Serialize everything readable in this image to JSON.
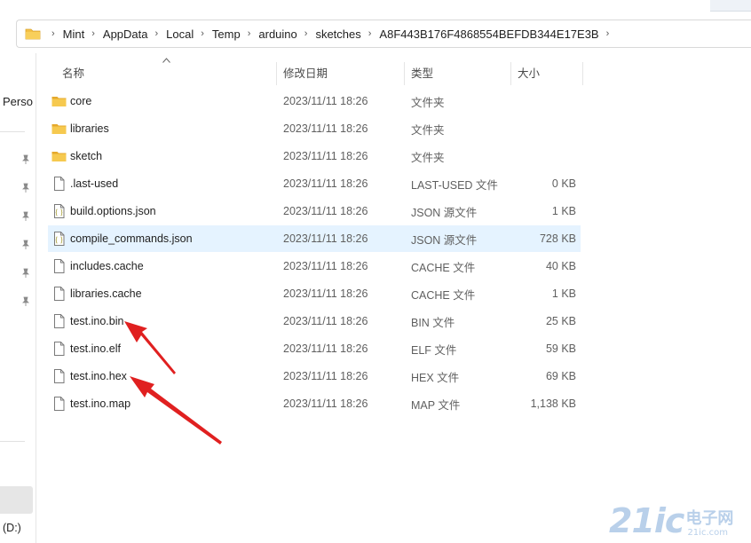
{
  "breadcrumb": [
    "Mint",
    "AppData",
    "Local",
    "Temp",
    "arduino",
    "sketches",
    "A8F443B176F4868554BEFDB344E17E3B"
  ],
  "sidebar": {
    "truncated_label": "Perso",
    "drive_label": "(D:)"
  },
  "columns": {
    "name": "名称",
    "date": "修改日期",
    "type": "类型",
    "size": "大小"
  },
  "files": [
    {
      "name": "core",
      "date": "2023/11/11 18:26",
      "type": "文件夹",
      "size": "",
      "icon": "folder-icon"
    },
    {
      "name": "libraries",
      "date": "2023/11/11 18:26",
      "type": "文件夹",
      "size": "",
      "icon": "folder-icon"
    },
    {
      "name": "sketch",
      "date": "2023/11/11 18:26",
      "type": "文件夹",
      "size": "",
      "icon": "folder-icon"
    },
    {
      "name": ".last-used",
      "date": "2023/11/11 18:26",
      "type": "LAST-USED 文件",
      "size": "0 KB",
      "icon": "file-icon"
    },
    {
      "name": "build.options.json",
      "date": "2023/11/11 18:26",
      "type": "JSON 源文件",
      "size": "1 KB",
      "icon": "json-file-icon"
    },
    {
      "name": "compile_commands.json",
      "date": "2023/11/11 18:26",
      "type": "JSON 源文件",
      "size": "728 KB",
      "icon": "json-file-icon",
      "selected": true
    },
    {
      "name": "includes.cache",
      "date": "2023/11/11 18:26",
      "type": "CACHE 文件",
      "size": "40 KB",
      "icon": "file-icon"
    },
    {
      "name": "libraries.cache",
      "date": "2023/11/11 18:26",
      "type": "CACHE 文件",
      "size": "1 KB",
      "icon": "file-icon"
    },
    {
      "name": "test.ino.bin",
      "date": "2023/11/11 18:26",
      "type": "BIN 文件",
      "size": "25 KB",
      "icon": "file-icon"
    },
    {
      "name": "test.ino.elf",
      "date": "2023/11/11 18:26",
      "type": "ELF 文件",
      "size": "59 KB",
      "icon": "file-icon"
    },
    {
      "name": "test.ino.hex",
      "date": "2023/11/11 18:26",
      "type": "HEX 文件",
      "size": "69 KB",
      "icon": "file-icon"
    },
    {
      "name": "test.ino.map",
      "date": "2023/11/11 18:26",
      "type": "MAP 文件",
      "size": "1,138 KB",
      "icon": "file-icon"
    }
  ],
  "colors": {
    "selection": "#e5f3ff",
    "folder": "#f4c046",
    "annotation_arrow": "#e02020"
  },
  "watermark": {
    "big": "21ic",
    "cn": "电子网",
    "domain": "21ic.com"
  }
}
